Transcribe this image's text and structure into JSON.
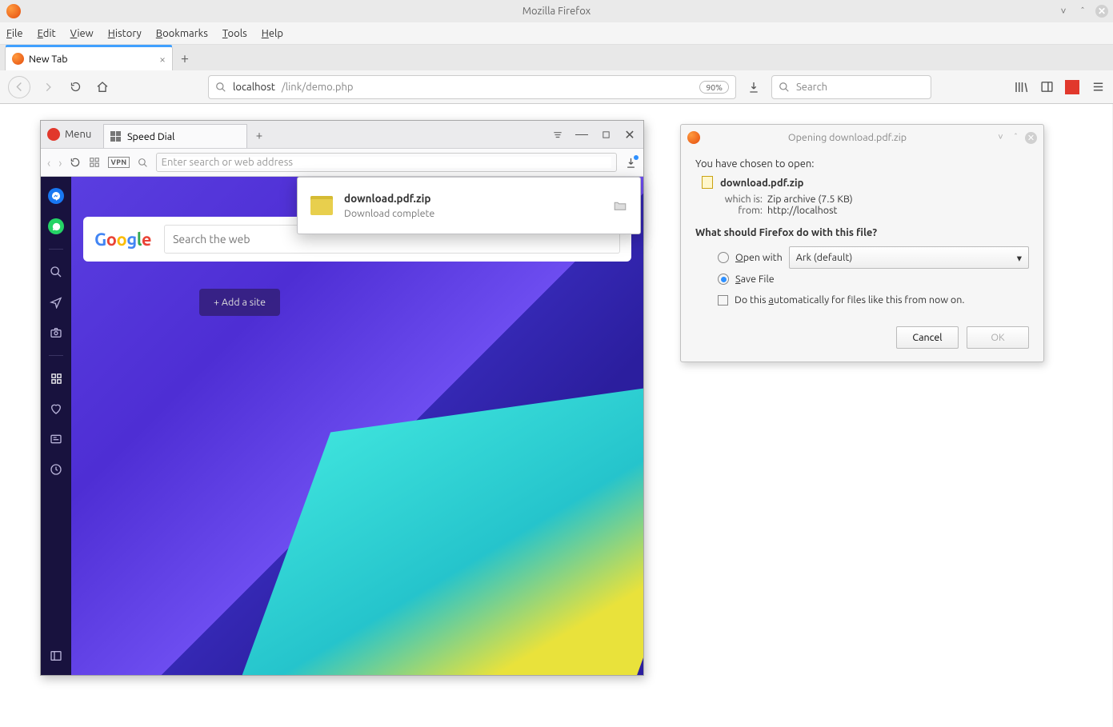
{
  "window": {
    "title": "Mozilla Firefox"
  },
  "menubar": {
    "file": "File",
    "edit": "Edit",
    "view": "View",
    "history": "History",
    "bookmarks": "Bookmarks",
    "tools": "Tools",
    "help": "Help"
  },
  "tab": {
    "label": "New Tab"
  },
  "urlbar": {
    "host": "localhost",
    "path": "/link/demo.php",
    "zoom": "90%"
  },
  "searchbar": {
    "placeholder": "Search"
  },
  "opera": {
    "menu": "Menu",
    "tab": "Speed Dial",
    "addressPlaceholder": "Enter search or web address",
    "searchPlaceholder": "Search the web",
    "addSite": "+  Add a site",
    "download": {
      "name": "download.pdf.zip",
      "status": "Download complete"
    }
  },
  "dialog": {
    "title": "Opening download.pdf.zip",
    "chosen": "You have chosen to open:",
    "filename": "download.pdf.zip",
    "whichIsLabel": "which is:",
    "whichIs": "Zip archive (7.5 KB)",
    "fromLabel": "from:",
    "from": "http://localhost",
    "prompt": "What should Firefox do with this file?",
    "openWith": "Open with",
    "app": "Ark (default)",
    "saveFile": "Save File",
    "autoCheck": "Do this automatically for files like this from now on.",
    "cancel": "Cancel",
    "ok": "OK"
  }
}
